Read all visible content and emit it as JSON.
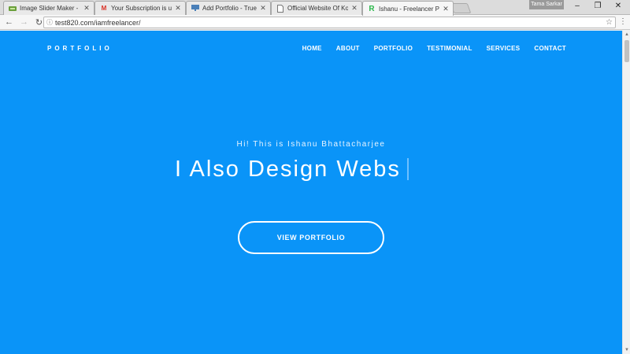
{
  "browser": {
    "tabs": [
      {
        "title": "Image Slider Maker - Fre",
        "icon": "image-icon"
      },
      {
        "title": "Your Subscription is up f",
        "icon": "gmail-icon"
      },
      {
        "title": "Add Portfolio - Truelance",
        "icon": "monitor-icon"
      },
      {
        "title": "Official Website Of Kolka",
        "icon": "document-icon"
      },
      {
        "title": "Ishanu - Freelancer Portf",
        "icon": "r-logo-icon"
      }
    ],
    "profile_name": "Tama Sarkar",
    "url": "test820.com/iamfreelancer/"
  },
  "site": {
    "brand": "PORTFOLIO",
    "nav": [
      "HOME",
      "ABOUT",
      "PORTFOLIO",
      "TESTIMONIAL",
      "SERVICES",
      "CONTACT"
    ],
    "hero_subtitle": "Hi! This is Ishanu Bhattacharjee",
    "hero_title": "I Also Design Webs",
    "cta_label": "VIEW PORTFOLIO"
  },
  "colors": {
    "page_background": "#0a94f8",
    "text": "#ffffff"
  }
}
